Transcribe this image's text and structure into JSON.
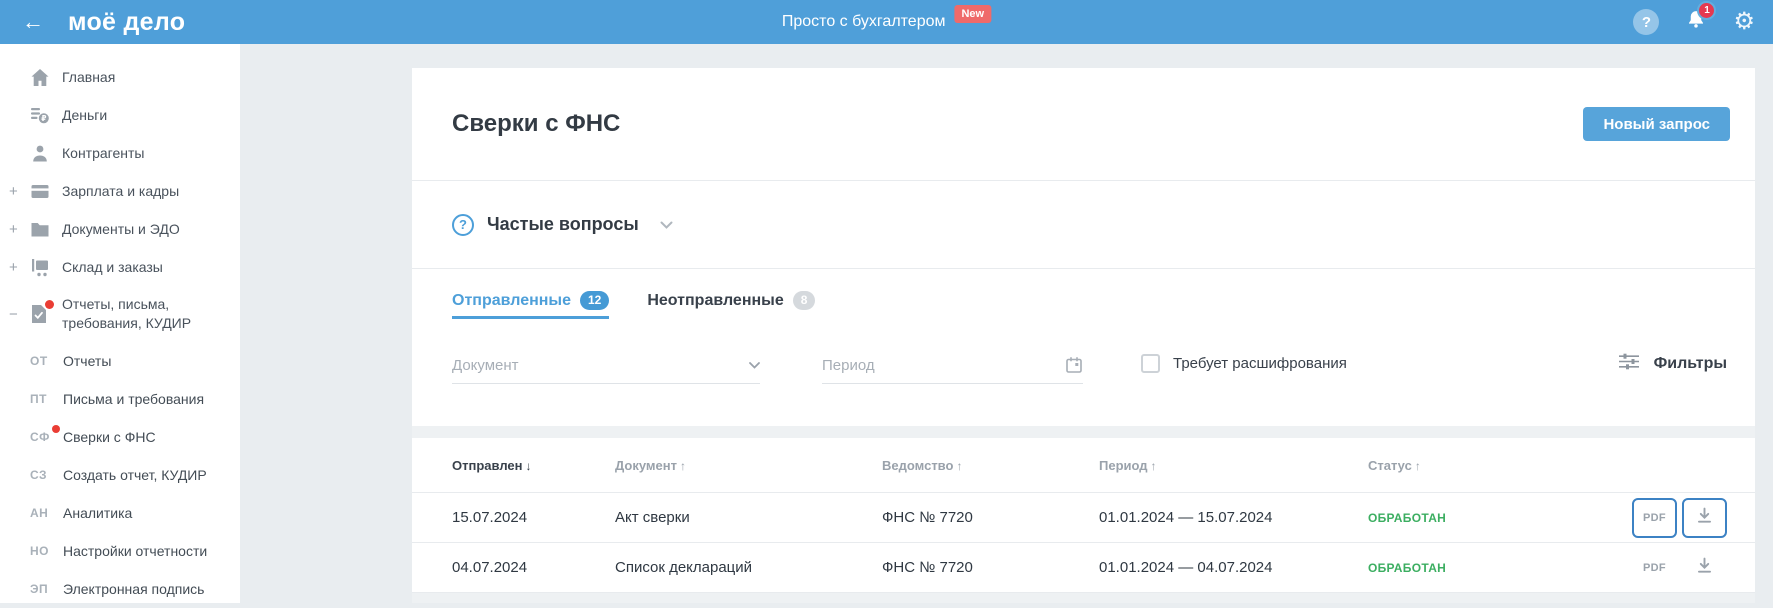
{
  "header": {
    "back_arrow": "←",
    "logo": "моё дело",
    "tagline": "Просто с бухгалтером",
    "new_badge": "New",
    "help_glyph": "?",
    "notification_count": "1",
    "gear_glyph": "⚙"
  },
  "sidebar": {
    "items": [
      {
        "label": "Главная",
        "icon": "home-icon",
        "expander": ""
      },
      {
        "label": "Деньги",
        "icon": "money-icon",
        "expander": ""
      },
      {
        "label": "Контрагенты",
        "icon": "contractors-icon",
        "expander": ""
      },
      {
        "label": "Зарплата и кадры",
        "icon": "salary-icon",
        "expander": "+"
      },
      {
        "label": "Документы и ЭДО",
        "icon": "documents-icon",
        "expander": "+"
      },
      {
        "label": "Склад и заказы",
        "icon": "warehouse-icon",
        "expander": "+"
      },
      {
        "label": "Отчеты, письма, требования, КУДИР",
        "icon": "reports-icon",
        "expander": "−",
        "has_red_dot": true
      }
    ],
    "subitems": [
      {
        "prefix": "ОТ",
        "label": "Отчеты"
      },
      {
        "prefix": "ПТ",
        "label": "Письма и требования"
      },
      {
        "prefix": "СФ",
        "label": "Сверки с ФНС",
        "has_red_dot": true
      },
      {
        "prefix": "СЗ",
        "label": "Создать отчет, КУДИР"
      },
      {
        "prefix": "АН",
        "label": "Аналитика"
      },
      {
        "prefix": "НО",
        "label": "Настройки отчетности"
      },
      {
        "prefix": "ЭП",
        "label": "Электронная подпись"
      }
    ]
  },
  "main": {
    "title": "Сверки с ФНС",
    "new_request_button": "Новый запрос",
    "faq": {
      "icon_glyph": "?",
      "label": "Частые вопросы"
    },
    "tabs": {
      "sent": {
        "label": "Отправленные",
        "count": "12"
      },
      "unsent": {
        "label": "Неотправленные",
        "count": "8"
      }
    },
    "filters": {
      "document_placeholder": "Документ",
      "period_placeholder": "Период",
      "checkbox_label": "Требует расшифрования",
      "checkbox_checked": false,
      "filters_label": "Фильтры"
    },
    "table": {
      "headers": {
        "sent": "Отправлен",
        "document": "Документ",
        "agency": "Ведомство",
        "period": "Период",
        "status": "Статус"
      },
      "sort": {
        "down": "↓",
        "up": "↑"
      },
      "rows": [
        {
          "sent": "15.07.2024",
          "document": "Акт сверки",
          "agency": "ФНС № 7720",
          "period": "01.01.2024 — 15.07.2024",
          "status": "ОБРАБОТАН",
          "pdf": "PDF"
        },
        {
          "sent": "04.07.2024",
          "document": "Список деклараций",
          "agency": "ФНС № 7720",
          "period": "01.01.2024 — 04.07.2024",
          "status": "ОБРАБОТАН",
          "pdf": "PDF"
        }
      ]
    }
  },
  "colors": {
    "accent_blue": "#4f9fd9",
    "action_border_blue": "#3c82c4",
    "status_green": "#3cae61",
    "notification_red": "#e63950",
    "new_badge_red": "#ef6a6a"
  }
}
